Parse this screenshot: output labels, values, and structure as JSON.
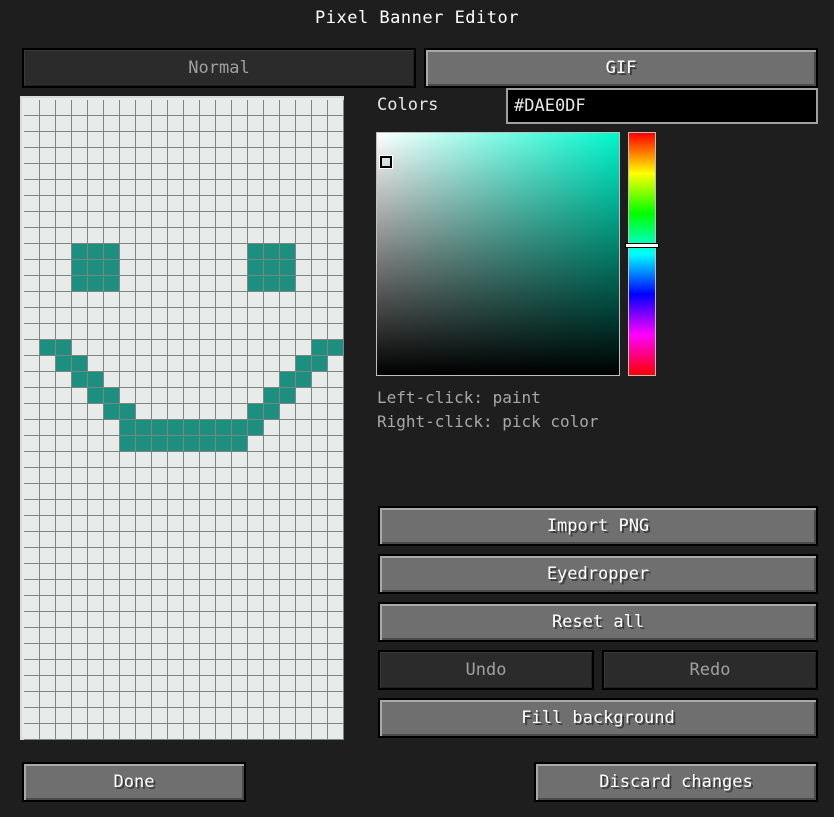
{
  "window": {
    "title": "Pixel Banner Editor"
  },
  "mode_tabs": {
    "normal": "Normal",
    "gif": "GIF"
  },
  "colors": {
    "label": "Colors",
    "hex_value": "#DAE0DF",
    "paint_color": "#1c8f7f",
    "bg_color": "#e7ecea"
  },
  "hints": {
    "left_click": "Left-click: paint",
    "right_click": "Right-click: pick color"
  },
  "actions": {
    "import_png": "Import PNG",
    "eyedropper": "Eyedropper",
    "reset_all": "Reset all",
    "undo": "Undo",
    "redo": "Redo",
    "fill_background": "Fill background"
  },
  "footer": {
    "done": "Done",
    "discard": "Discard changes"
  },
  "canvas": {
    "columns": 20,
    "rows": 40,
    "painted_rows": [
      {
        "row": 9,
        "cols": [
          3,
          4,
          5,
          14,
          15,
          16
        ]
      },
      {
        "row": 10,
        "cols": [
          3,
          4,
          5,
          14,
          15,
          16
        ]
      },
      {
        "row": 11,
        "cols": [
          3,
          4,
          5,
          14,
          15,
          16
        ]
      },
      {
        "row": 15,
        "cols": [
          1,
          2,
          18,
          19
        ]
      },
      {
        "row": 16,
        "cols": [
          2,
          3,
          17,
          18
        ]
      },
      {
        "row": 17,
        "cols": [
          3,
          4,
          16,
          17
        ]
      },
      {
        "row": 18,
        "cols": [
          4,
          5,
          15,
          16
        ]
      },
      {
        "row": 19,
        "cols": [
          5,
          6,
          14,
          15
        ]
      },
      {
        "row": 20,
        "cols": [
          6,
          7,
          8,
          9,
          10,
          11,
          12,
          13,
          14
        ]
      },
      {
        "row": 21,
        "cols": [
          6,
          7,
          8,
          9,
          10,
          11,
          12,
          13
        ]
      }
    ]
  }
}
